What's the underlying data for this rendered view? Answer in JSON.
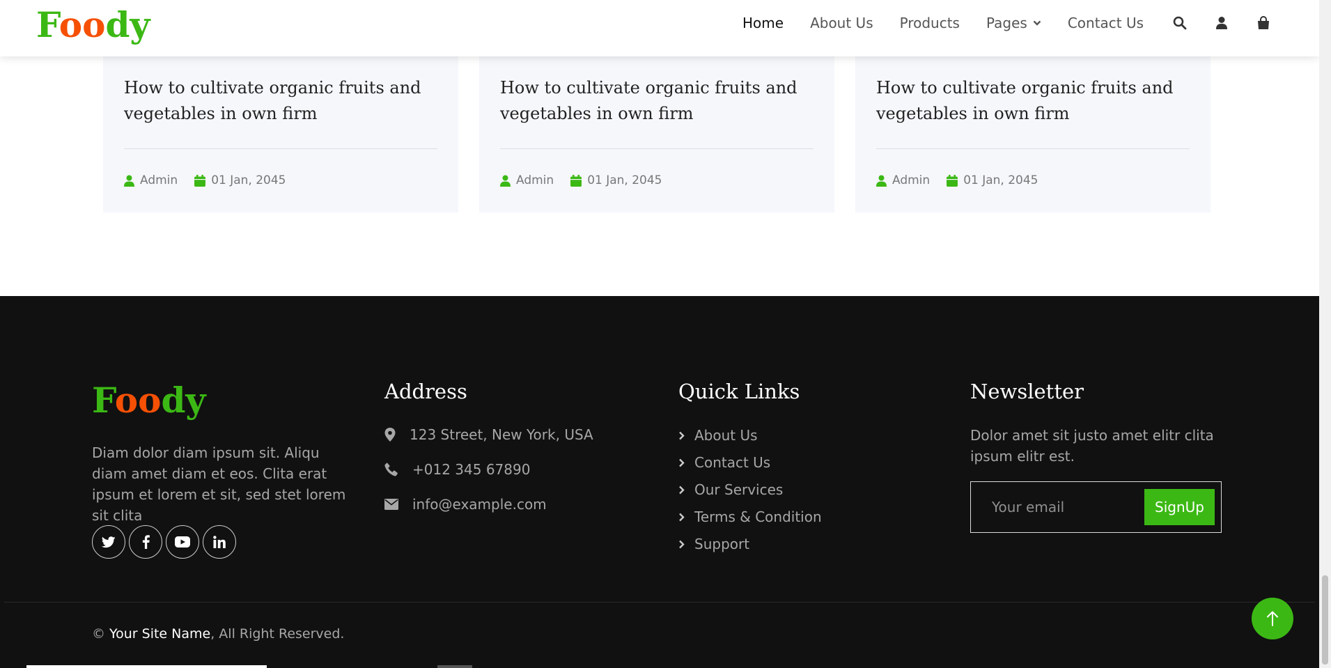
{
  "brand": {
    "part1": "F",
    "part2": "oo",
    "part3": "dy",
    "green": "#3cb815",
    "orange": "#f65005"
  },
  "nav": {
    "links": [
      {
        "label": "Home",
        "active": true
      },
      {
        "label": "About Us"
      },
      {
        "label": "Products"
      },
      {
        "label": "Pages",
        "dropdown": true
      },
      {
        "label": "Contact Us"
      }
    ],
    "icons": [
      "search-icon",
      "user-icon",
      "shopping-bag-icon"
    ]
  },
  "blog_cards": [
    {
      "title": "How to cultivate organic fruits and vegetables in own firm",
      "author": "Admin",
      "date": "01 Jan, 2045"
    },
    {
      "title": "How to cultivate organic fruits and vegetables in own firm",
      "author": "Admin",
      "date": "01 Jan, 2045"
    },
    {
      "title": "How to cultivate organic fruits and vegetables in own firm",
      "author": "Admin",
      "date": "01 Jan, 2045"
    }
  ],
  "footer": {
    "about": "Diam dolor diam ipsum sit. Aliqu diam amet diam et eos. Clita erat ipsum et lorem et sit, sed stet lorem sit clita",
    "socials": [
      "twitter-icon",
      "facebook-icon",
      "youtube-icon",
      "linkedin-icon"
    ],
    "address": {
      "heading": "Address",
      "street": "123 Street, New York, USA",
      "phone": "+012 345 67890",
      "email": "info@example.com"
    },
    "quick_links": {
      "heading": "Quick Links",
      "items": [
        "About Us",
        "Contact Us",
        "Our Services",
        "Terms & Condition",
        "Support"
      ]
    },
    "newsletter": {
      "heading": "Newsletter",
      "text": "Dolor amet sit justo amet elitr clita ipsum elitr est.",
      "placeholder": "Your email",
      "button": "SignUp"
    },
    "copyright": {
      "symbol": "©",
      "site": "Your Site Name",
      "rest": ", All Right Reserved."
    }
  }
}
